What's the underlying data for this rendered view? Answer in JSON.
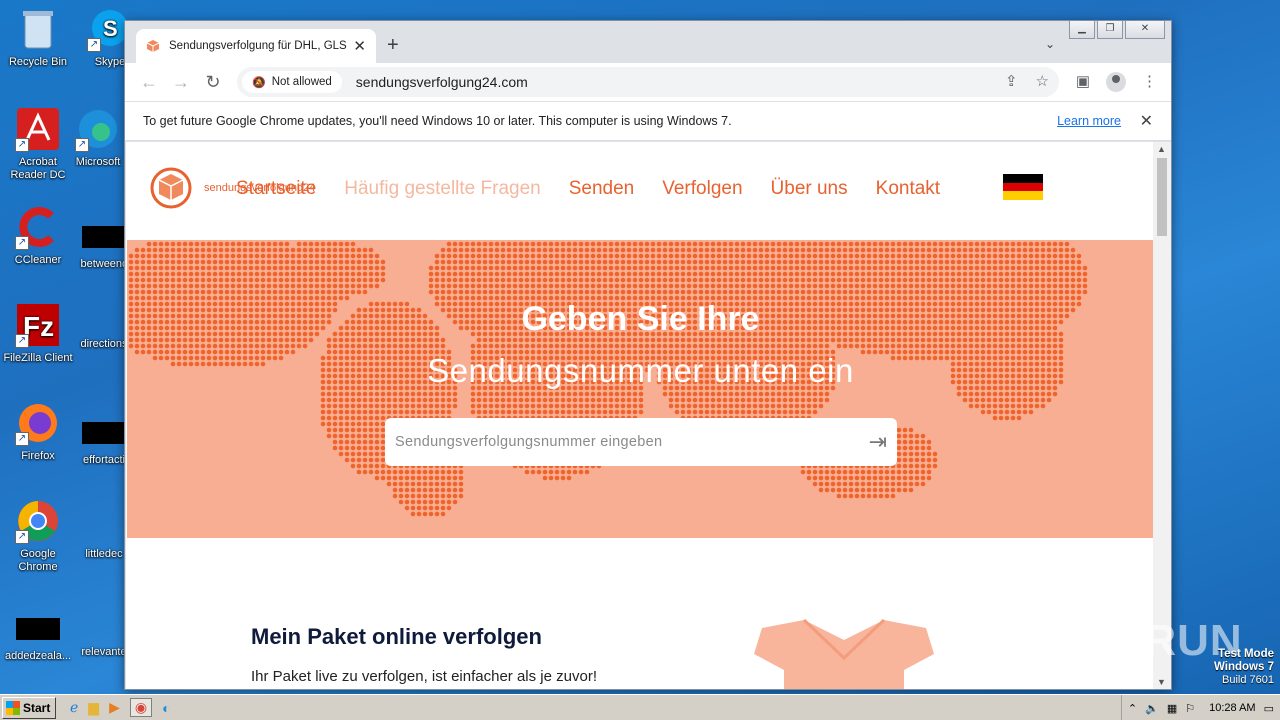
{
  "desktop": {
    "icons": [
      {
        "label": "Recycle Bin",
        "icon": "recycle-bin-icon"
      },
      {
        "label": "Skype",
        "icon": "skype-icon"
      },
      {
        "label": "Acrobat Reader DC",
        "icon": "acrobat-icon"
      },
      {
        "label": "Microsoft",
        "icon": "edge-icon"
      },
      {
        "label": "CCleaner",
        "icon": "ccleaner-icon"
      },
      {
        "label": "betweenc",
        "icon": "file-icon"
      },
      {
        "label": "FileZilla Client",
        "icon": "filezilla-icon"
      },
      {
        "label": "directions",
        "icon": "file-icon"
      },
      {
        "label": "Firefox",
        "icon": "firefox-icon"
      },
      {
        "label": "effortacti",
        "icon": "file-icon"
      },
      {
        "label": "Google Chrome",
        "icon": "chrome-icon"
      },
      {
        "label": "littledec",
        "icon": "file-icon"
      },
      {
        "label": "addedzeala...",
        "icon": "file-icon"
      },
      {
        "label": "relevante",
        "icon": "file-icon"
      }
    ]
  },
  "browser": {
    "tab_title": "Sendungsverfolgung für DHL, GLS, U",
    "permission_chip": "Not allowed",
    "url": "sendungsverfolgung24.com",
    "infobar_text": "To get future Google Chrome updates, you'll need Windows 10 or later. This computer is using Windows 7.",
    "infobar_link": "Learn more"
  },
  "site": {
    "logo_text": "sendungsverfolgung24",
    "nav": [
      "Startseite",
      "Häufig gestellte Fragen",
      "Senden",
      "Verfolgen",
      "Über uns",
      "Kontakt"
    ],
    "flag_colors": [
      "#000000",
      "#dd0000",
      "#ffce00"
    ],
    "hero_title": "Geben Sie Ihre",
    "hero_subtitle": "Sendungsnummer unten ein",
    "search_placeholder": "Sendungsverfolgungsnummer eingeben",
    "section_title": "Mein Paket online verfolgen",
    "section_text": "Ihr Paket live zu verfolgen, ist einfacher als je zuvor!",
    "accent": "#e8622f",
    "hero_bg": "#f8ae93"
  },
  "taskbar": {
    "start_label": "Start",
    "clock": "10:28 AM"
  },
  "watermark": {
    "line1": "Test Mode",
    "line2": "Windows 7",
    "line3": "Build 7601",
    "brand": "ANY RUN"
  }
}
